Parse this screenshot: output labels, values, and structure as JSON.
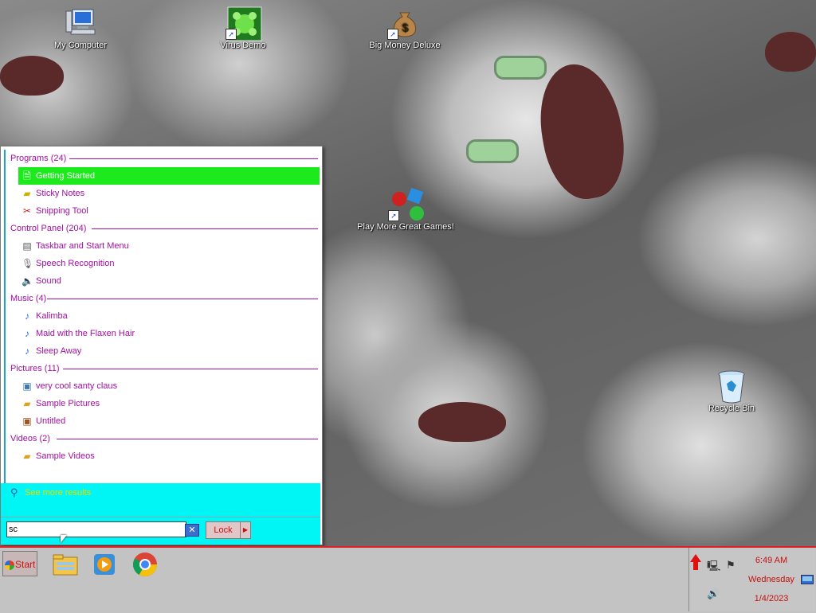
{
  "desktop": {
    "icons": [
      {
        "label": "My Computer",
        "icon": "computer-icon"
      },
      {
        "label": "Virus Demo",
        "icon": "virus-demo-icon"
      },
      {
        "label": "Big Money Deluxe",
        "icon": "money-bag-icon"
      },
      {
        "label": "Play More Great Games!",
        "icon": "games-icon"
      },
      {
        "label": "Recycle Bin",
        "icon": "recycle-bin-icon"
      }
    ]
  },
  "start_menu": {
    "categories": [
      {
        "title": "Programs (24)",
        "items": [
          {
            "label": "Getting Started",
            "icon": "getting-started-icon",
            "selected": true
          },
          {
            "label": "Sticky Notes",
            "icon": "sticky-notes-icon"
          },
          {
            "label": "Snipping Tool",
            "icon": "snipping-tool-icon"
          }
        ]
      },
      {
        "title": "Control Panel (204)",
        "items": [
          {
            "label": "Taskbar and Start Menu",
            "icon": "taskbar-icon"
          },
          {
            "label": "Speech Recognition",
            "icon": "microphone-icon"
          },
          {
            "label": "Sound",
            "icon": "speaker-icon"
          }
        ]
      },
      {
        "title": "Music (4)",
        "items": [
          {
            "label": "Kalimba",
            "icon": "music-file-icon"
          },
          {
            "label": "Maid with the Flaxen Hair",
            "icon": "music-file-icon"
          },
          {
            "label": "Sleep Away",
            "icon": "music-file-icon"
          }
        ]
      },
      {
        "title": "Pictures (11)",
        "items": [
          {
            "label": "very cool santy claus",
            "icon": "image-file-icon"
          },
          {
            "label": "Sample Pictures",
            "icon": "folder-icon"
          },
          {
            "label": "Untitled",
            "icon": "image-file-icon"
          }
        ]
      },
      {
        "title": "Videos (2)",
        "items": [
          {
            "label": "Sample Videos",
            "icon": "folder-icon"
          }
        ]
      }
    ],
    "see_more": "See more results",
    "search": {
      "value": "sc"
    },
    "lock_label": "Lock"
  },
  "taskbar": {
    "start_label": "Start",
    "apps": [
      "file-explorer-icon",
      "media-player-icon",
      "chrome-icon"
    ],
    "clock": {
      "time": "6:49 AM",
      "day": "Wednesday",
      "date": "1/4/2023"
    }
  },
  "colors": {
    "accent_text": "#a010a0",
    "selection": "#1dea1d",
    "menu_footer": "#00f5f5",
    "taskbar_border": "#e02020",
    "clock_text": "#c81010"
  }
}
